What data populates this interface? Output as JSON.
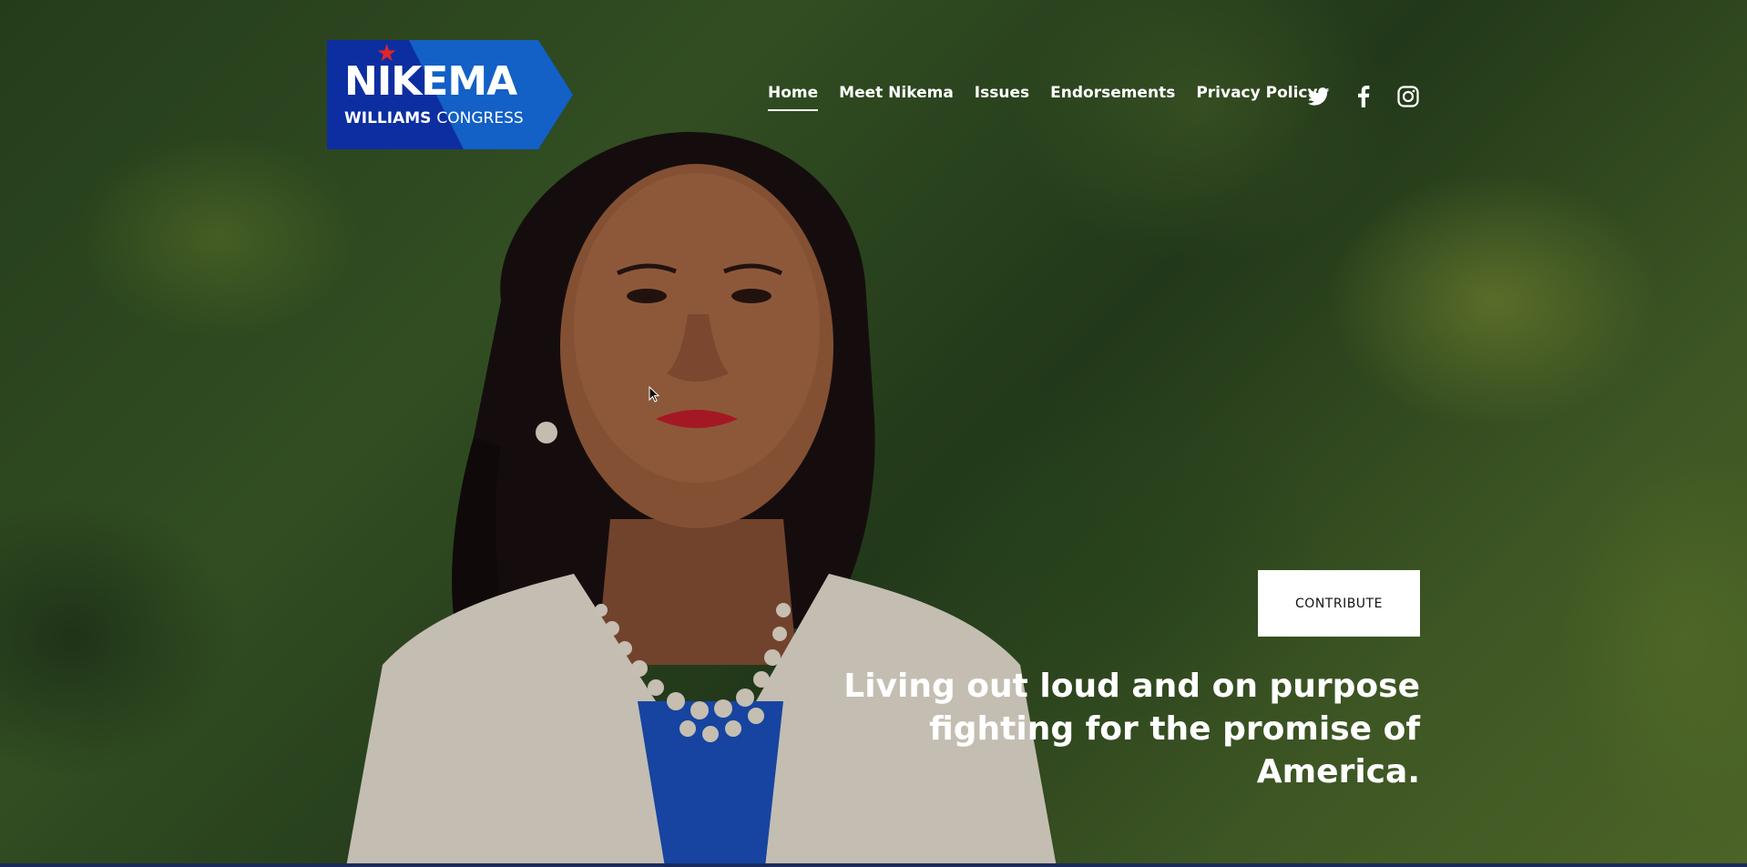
{
  "brand": {
    "name_main": "NIKEMA",
    "name_first": "WILLIAMS",
    "name_suffix": "CONGRESS",
    "colors": {
      "navy": "#0d2ea0",
      "blue": "#1360c6",
      "star_red": "#e0252d"
    }
  },
  "nav": {
    "items": [
      {
        "label": "Home",
        "active": true
      },
      {
        "label": "Meet Nikema",
        "active": false
      },
      {
        "label": "Issues",
        "active": false
      },
      {
        "label": "Endorsements",
        "active": false
      },
      {
        "label": "Privacy Policy",
        "active": false
      }
    ]
  },
  "social": {
    "icons": [
      "twitter-icon",
      "facebook-icon",
      "instagram-icon"
    ]
  },
  "hero": {
    "cta_label": "CONTRIBUTE",
    "headline": "Living out loud and on purpose fighting for the promise of America."
  }
}
